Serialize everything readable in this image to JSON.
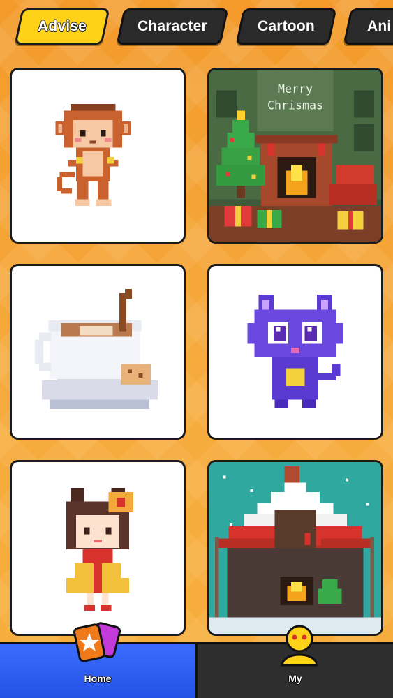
{
  "tabs": [
    {
      "label": "Advise",
      "active": true
    },
    {
      "label": "Character",
      "active": false
    },
    {
      "label": "Cartoon",
      "active": false
    },
    {
      "label": "Ani",
      "active": false
    }
  ],
  "cards": [
    {
      "icon": "monkey-pixel-art"
    },
    {
      "icon": "christmas-fireplace-pixel-art",
      "caption_line1": "Merry",
      "caption_line2": "Chrismas"
    },
    {
      "icon": "coffee-cup-pixel-art"
    },
    {
      "icon": "purple-cat-pixel-art"
    },
    {
      "icon": "cat-girl-pixel-art"
    },
    {
      "icon": "snowy-cabin-pixel-art"
    }
  ],
  "nav": {
    "home_label": "Home",
    "my_label": "My"
  },
  "colors": {
    "background": "#f39a2a",
    "active_tab": "#ffd21a",
    "home_tab": "#2451e6",
    "my_tab": "#2e2e2e"
  }
}
